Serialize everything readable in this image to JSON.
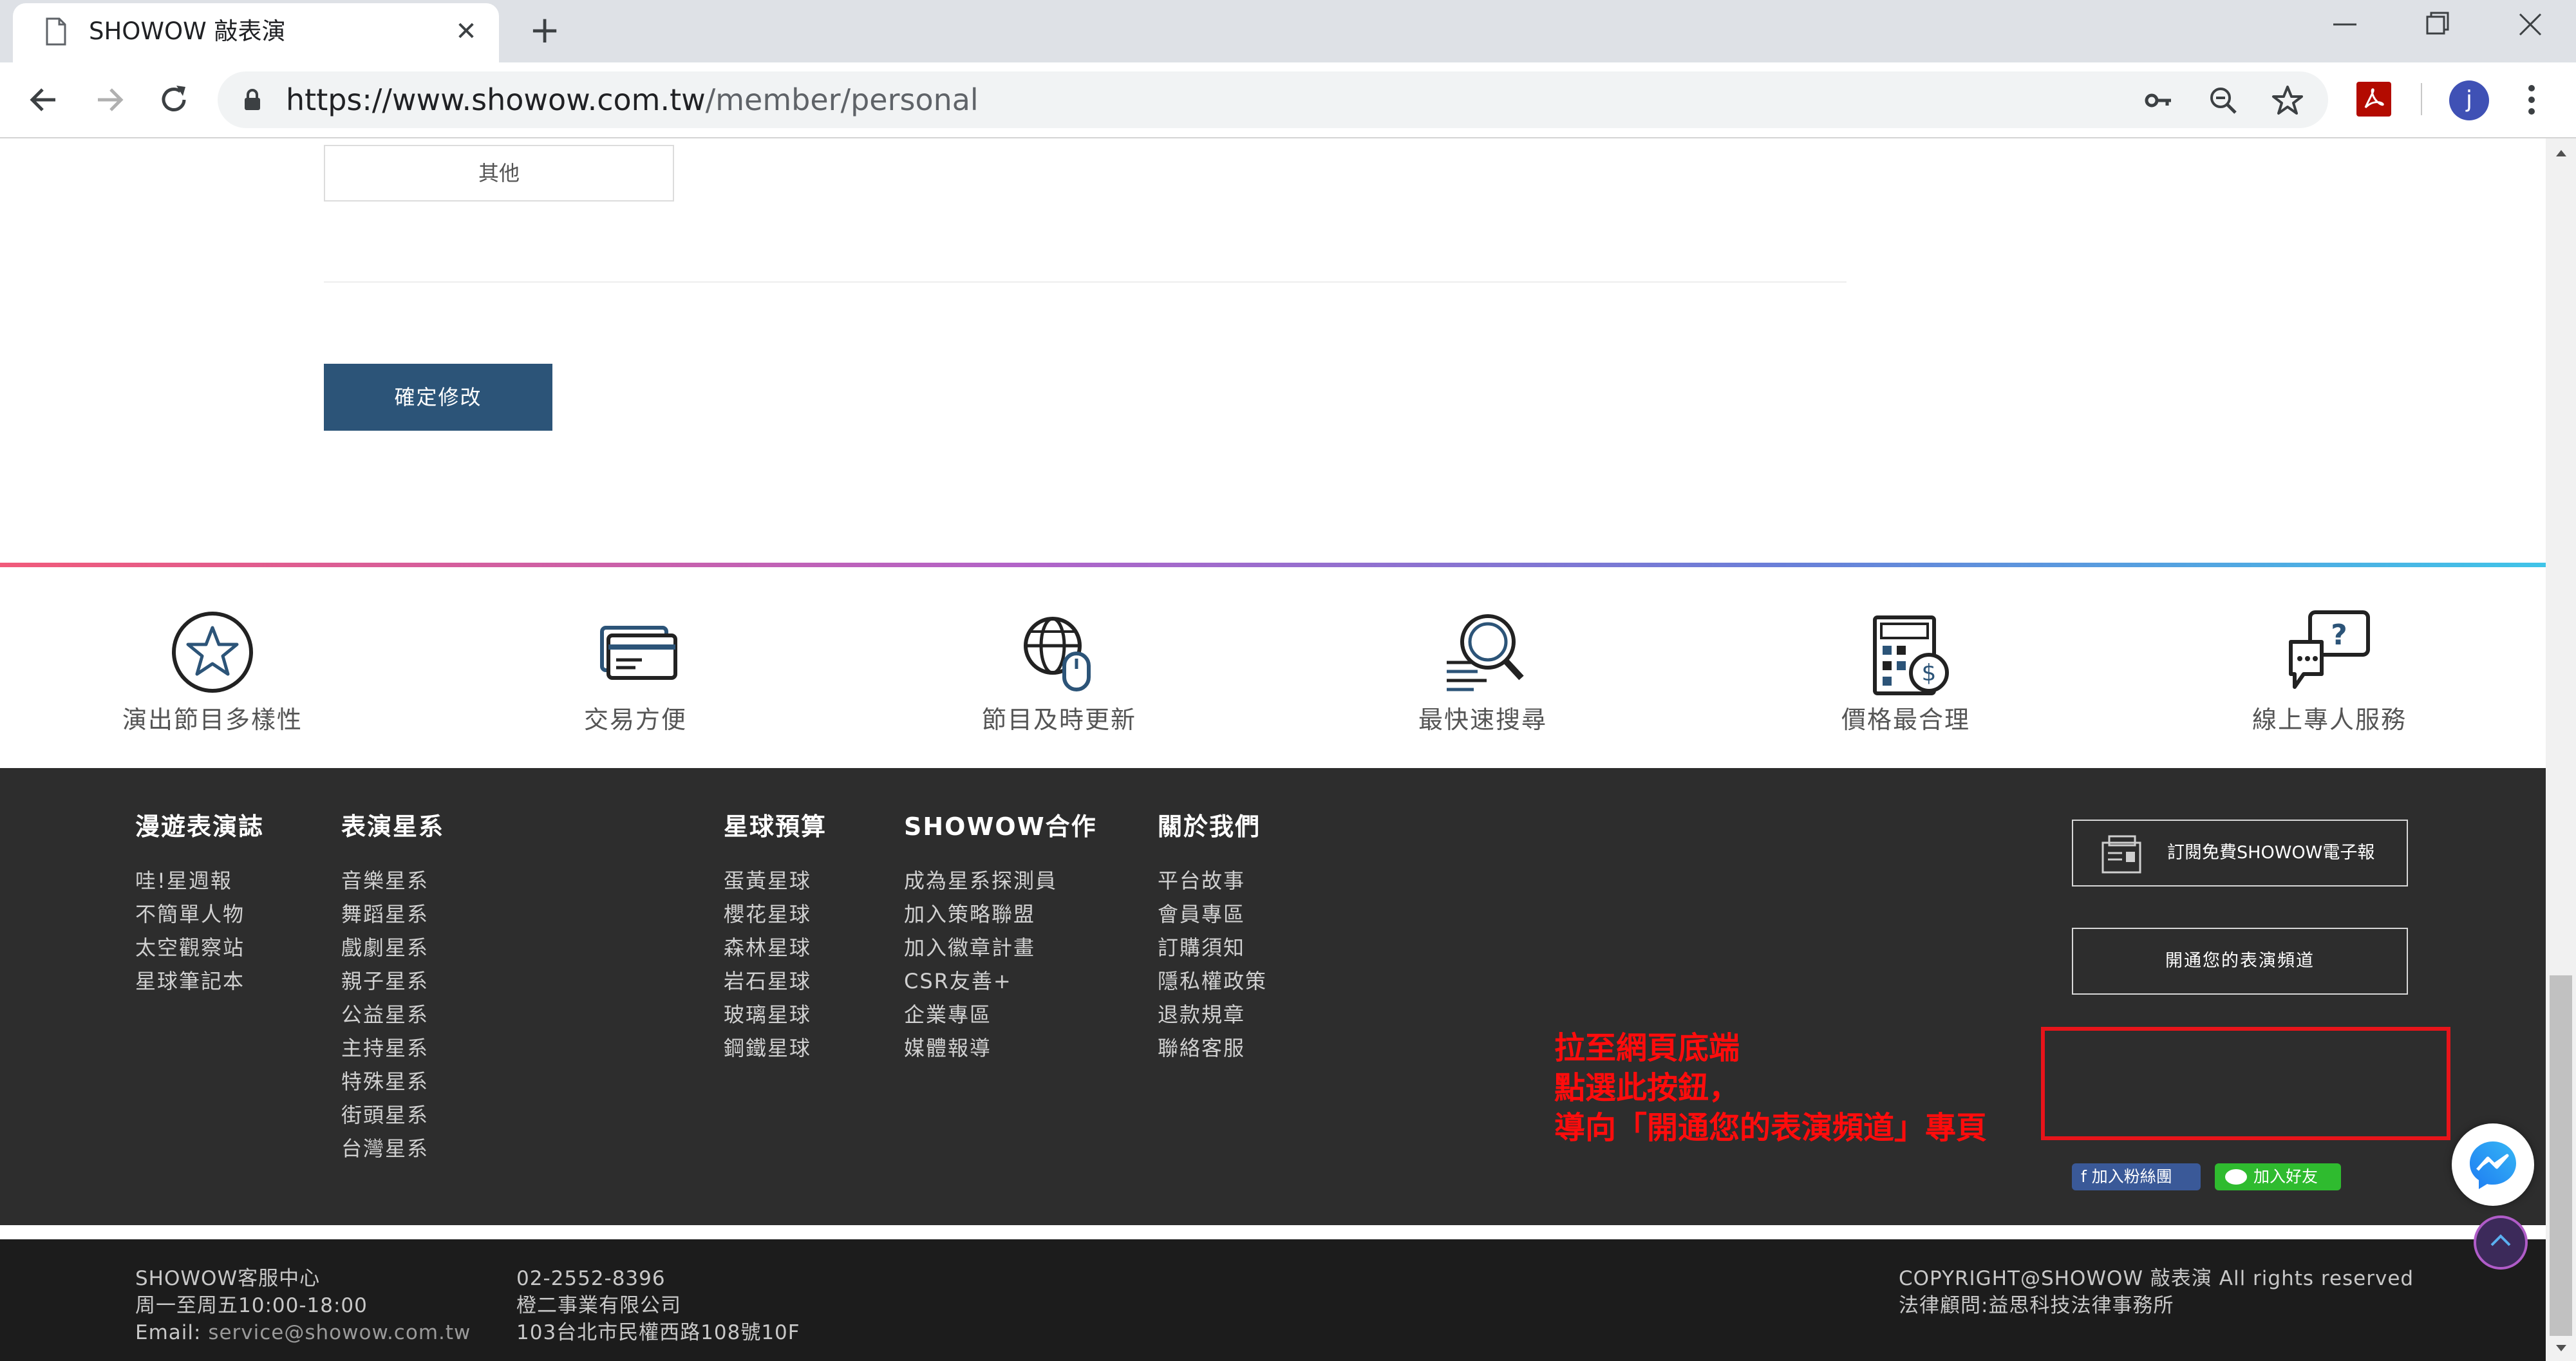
{
  "browser": {
    "tab_title": "SHOWOW 敲表演",
    "tab_close": "✕",
    "new_tab": "+",
    "url_host": "https://www.showow.com.tw",
    "url_path": "/member/personal",
    "profile_initial": "j"
  },
  "form": {
    "option_label": "其他",
    "confirm_button": "確定修改"
  },
  "features": [
    {
      "label": "演出節目多樣性",
      "icon": "star-circle-icon"
    },
    {
      "label": "交易方便",
      "icon": "credit-card-icon"
    },
    {
      "label": "節目及時更新",
      "icon": "globe-mouse-icon"
    },
    {
      "label": "最快速搜尋",
      "icon": "magnifier-icon"
    },
    {
      "label": "價格最合理",
      "icon": "calculator-dollar-icon"
    },
    {
      "label": "線上專人服務",
      "icon": "chat-question-icon"
    }
  ],
  "footer": {
    "columns": [
      {
        "title": "漫遊表演誌",
        "items": [
          "哇!星週報",
          "不簡單人物",
          "太空觀察站",
          "星球筆記本"
        ]
      },
      {
        "title": "表演星系",
        "items": [
          "音樂星系",
          "舞蹈星系",
          "戲劇星系",
          "親子星系",
          "公益星系",
          "主持星系",
          "特殊星系",
          "街頭星系",
          "台灣星系"
        ]
      },
      {
        "title": "星球預算",
        "items": [
          "蛋黃星球",
          "櫻花星球",
          "森林星球",
          "岩石星球",
          "玻璃星球",
          "鋼鐵星球"
        ]
      },
      {
        "title": "SHOWOW合作",
        "items": [
          "成為星系探測員",
          "加入策略聯盟",
          "加入徽章計畫",
          "CSR友善+",
          "企業專區",
          "媒體報導"
        ]
      },
      {
        "title": "關於我們",
        "items": [
          "平台故事",
          "會員專區",
          "訂購須知",
          "隱私權政策",
          "退款規章",
          "聯絡客服"
        ]
      }
    ],
    "subscribe_label": "訂閱免費SHOWOW電子報",
    "open_channel_label": "開通您的表演頻道",
    "annotation": [
      "拉至網頁底端",
      "點選此按鈕，",
      "導向「開通您的表演頻道」專頁"
    ],
    "facebook_label": "f 加入粉絲團",
    "line_label": "加入好友"
  },
  "bottom": {
    "service_center": "SHOWOW客服中心",
    "hours": "周一至周五10:00-18:00",
    "email_label": "Email: ",
    "email": "service@showow.com.tw",
    "phone": "02-2552-8396",
    "company": "橙二事業有限公司",
    "address": "103台北市民權西路108號10F",
    "copyright": "COPYRIGHT@SHOWOW 敲表演 All rights reserved",
    "legal": "法律顧問:益思科技法律事務所"
  },
  "colors": {
    "footer_bg": "#2d2d2d",
    "bottom_bg": "#1c1c1c",
    "button_blue": "#2c5478",
    "highlight_red": "#e8141a",
    "annotation_red": "#ff0c0c"
  }
}
